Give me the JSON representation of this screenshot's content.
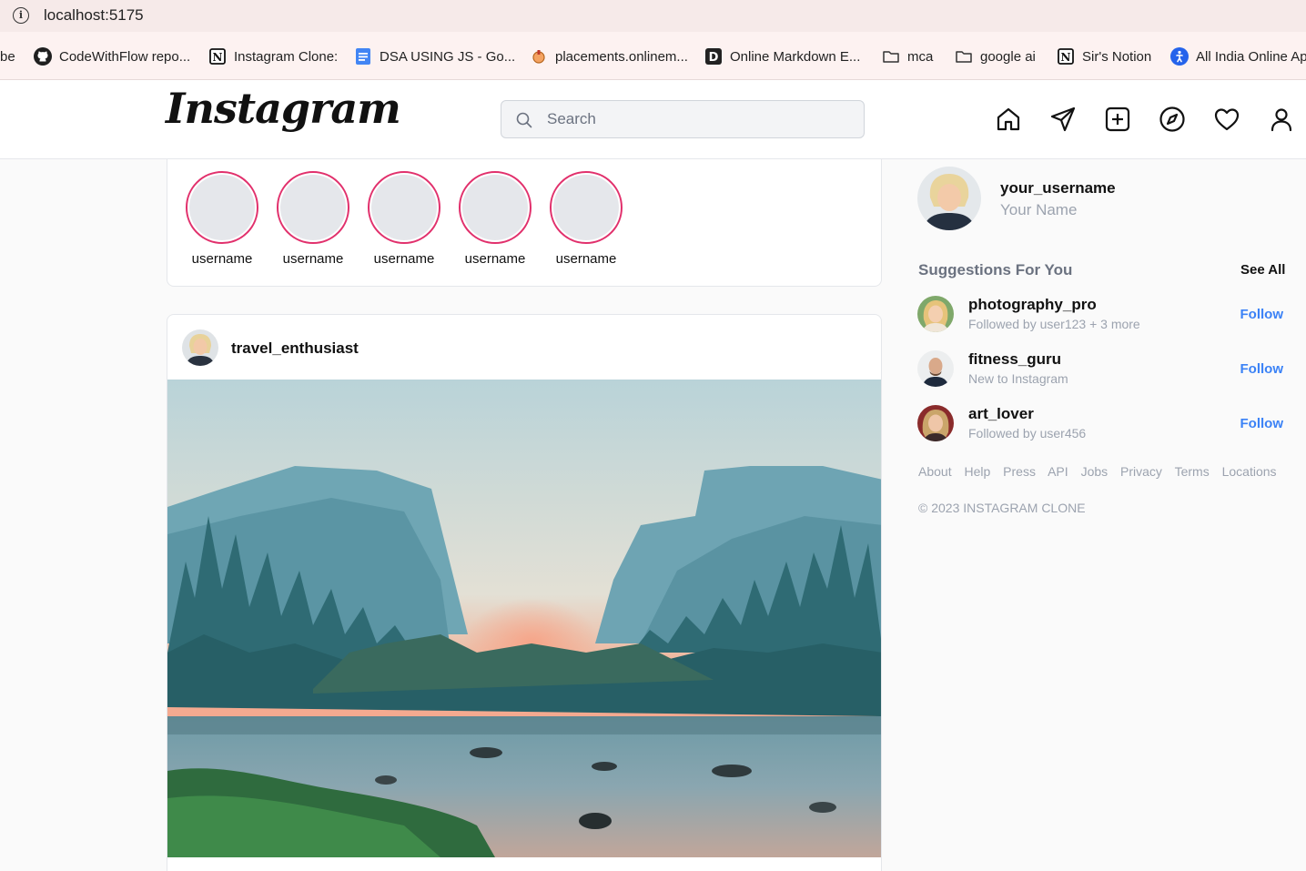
{
  "browser": {
    "url": "localhost:5175",
    "bookmarks": [
      {
        "label": "be",
        "icon": "bookmark-fragment"
      },
      {
        "label": "CodeWithFlow repo...",
        "icon": "github-icon"
      },
      {
        "label": "Instagram Clone:",
        "icon": "notion-icon"
      },
      {
        "label": "DSA USING JS - Go...",
        "icon": "google-docs-icon"
      },
      {
        "label": "placements.onlinem...",
        "icon": "site-icon"
      },
      {
        "label": "Online Markdown E...",
        "icon": "dillinger-icon"
      },
      {
        "label": "mca",
        "icon": "folder-icon"
      },
      {
        "label": "google ai",
        "icon": "folder-icon"
      },
      {
        "label": "Sir's Notion",
        "icon": "notion-icon"
      },
      {
        "label": "All India Online Ap",
        "icon": "accessibility-icon"
      }
    ]
  },
  "header": {
    "logo": "Instagram",
    "search_placeholder": "Search",
    "nav_icons": [
      "home-icon",
      "send-icon",
      "create-icon",
      "explore-icon",
      "heart-icon",
      "profile-icon"
    ]
  },
  "stories": [
    {
      "username": "username"
    },
    {
      "username": "username"
    },
    {
      "username": "username"
    },
    {
      "username": "username"
    },
    {
      "username": "username"
    }
  ],
  "post": {
    "username": "travel_enthusiast"
  },
  "sidebar": {
    "username": "your_username",
    "full_name": "Your Name",
    "suggestions_title": "Suggestions For You",
    "see_all": "See All",
    "suggestions": [
      {
        "username": "photography_pro",
        "subtitle": "Followed by user123 + 3 more",
        "action": "Follow"
      },
      {
        "username": "fitness_guru",
        "subtitle": "New to Instagram",
        "action": "Follow"
      },
      {
        "username": "art_lover",
        "subtitle": "Followed by user456",
        "action": "Follow"
      }
    ],
    "footer_links": [
      "About",
      "Help",
      "Press",
      "API",
      "Jobs",
      "Privacy",
      "Terms",
      "Locations"
    ],
    "copyright": "© 2023 INSTAGRAM CLONE"
  },
  "colors": {
    "story_ring": "#e1306c",
    "follow_link": "#3b82f6",
    "muted_text": "#9ca3af"
  }
}
